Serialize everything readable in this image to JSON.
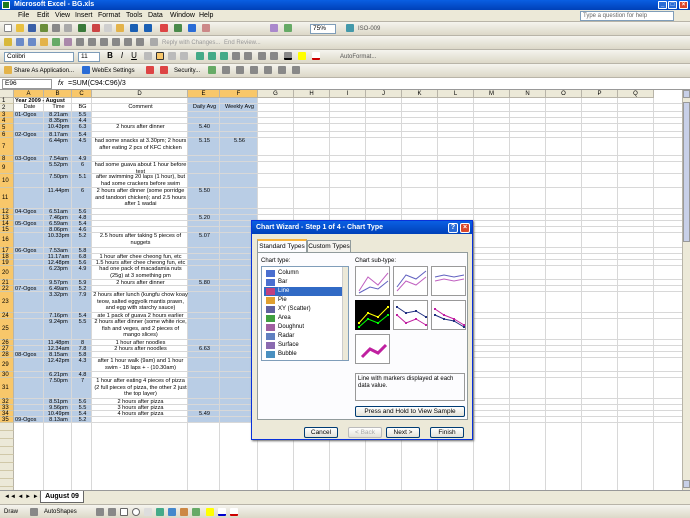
{
  "window": {
    "title": "Microsoft Excel - BG.xls"
  },
  "menu": [
    "File",
    "Edit",
    "View",
    "Insert",
    "Format",
    "Tools",
    "Data",
    "Window",
    "Help"
  ],
  "ask": "Type a question for help",
  "toolbar1": {
    "zoom": "75%",
    "font": "Colibri",
    "size": "11",
    "reply": "Reply with Changes...",
    "endreview": "End Review...",
    "dir": "ISO-009"
  },
  "toolbar2": {
    "share": "Share As Application...",
    "webex": "WebEx Settings",
    "security": "Security...",
    "autoformat": "AutoFormat..."
  },
  "formula": {
    "namebox": "E96",
    "fx": "fx",
    "value": "=SUM(C94:C96)/3"
  },
  "colors": {
    "selected": "#b9cde5",
    "header_sel": "#f8c76a",
    "title": "#0a5fe3"
  },
  "columns": [
    "A",
    "B",
    "C",
    "D",
    "E",
    "F",
    "G",
    "H",
    "I",
    "J",
    "K",
    "L",
    "M",
    "N",
    "O",
    "P",
    "Q"
  ],
  "rows": [
    {
      "n": "1",
      "a": "Year 2009 - August",
      "b": "",
      "c": "",
      "d": "",
      "e": "",
      "f": ""
    },
    {
      "n": "2",
      "a": "Date",
      "b": "Time",
      "c": "BG",
      "d": "Comment",
      "e": "Daily Avg",
      "f": "Weekly Avg"
    },
    {
      "n": "3",
      "a": "01-Ogos",
      "b": "8.21am",
      "c": "5.5",
      "d": "",
      "e": "",
      "f": ""
    },
    {
      "n": "4",
      "a": "",
      "b": "8.35pm",
      "c": "4.4",
      "d": "",
      "e": "",
      "f": ""
    },
    {
      "n": "5",
      "a": "",
      "b": "10.43pm",
      "c": "6.3",
      "d": "2 hours after dinner",
      "e": "5.40",
      "f": ""
    },
    {
      "n": "6",
      "a": "02-Ogos",
      "b": "8.17am",
      "c": "5.4",
      "d": "",
      "e": "",
      "f": ""
    },
    {
      "n": "7",
      "a": "",
      "b": "6.44pm",
      "c": "4.5",
      "d": "had some snacks at 3.30pm; 2 hours after eating 2 pcs of KFC chicken",
      "e": "5.15",
      "f": "5.56"
    },
    {
      "n": "8",
      "a": "03-Ogos",
      "b": "7.54am",
      "c": "4.9",
      "d": "",
      "e": "",
      "f": ""
    },
    {
      "n": "9",
      "a": "",
      "b": "5.52pm",
      "c": "6",
      "d": "had some guava about 1 hour before test",
      "e": "",
      "f": ""
    },
    {
      "n": "10",
      "a": "",
      "b": "7.50pm",
      "c": "5.1",
      "d": "after swimming 20 laps (1 hour), but had some crackers before swim",
      "e": "",
      "f": ""
    },
    {
      "n": "11",
      "a": "",
      "b": "11.44pm",
      "c": "6",
      "d": "2 hours after dinner (some porridge and tandoori chicken); and 2.5 hours after 1 wadai",
      "e": "5.50",
      "f": ""
    },
    {
      "n": "12",
      "a": "04-Ogos",
      "b": "6.51am",
      "c": "5.6",
      "d": "",
      "e": "",
      "f": ""
    },
    {
      "n": "13",
      "a": "",
      "b": "7.46pm",
      "c": "4.8",
      "d": "",
      "e": "5.20",
      "f": ""
    },
    {
      "n": "14",
      "a": "05-Ogos",
      "b": "6.59am",
      "c": "5.4",
      "d": "",
      "e": "",
      "f": ""
    },
    {
      "n": "15",
      "a": "",
      "b": "8.06pm",
      "c": "4.6",
      "d": "",
      "e": "",
      "f": ""
    },
    {
      "n": "16",
      "a": "",
      "b": "10.33pm",
      "c": "5.2",
      "d": "2.5 hours after taking 5 pieces of nuggets",
      "e": "5.07",
      "f": ""
    },
    {
      "n": "17",
      "a": "06-Ogos",
      "b": "7.53am",
      "c": "5.8",
      "d": "",
      "e": "",
      "f": ""
    },
    {
      "n": "18",
      "a": "",
      "b": "11.17am",
      "c": "6.8",
      "d": "1 hour after chee cheong fun, etc",
      "e": "",
      "f": ""
    },
    {
      "n": "19",
      "a": "",
      "b": "12.48pm",
      "c": "5.6",
      "d": "1.5 hours after chee cheong fun, etc",
      "e": "",
      "f": ""
    },
    {
      "n": "20",
      "a": "",
      "b": "6.23pm",
      "c": "4.9",
      "d": "had one pack of macadamia nuts (25g) at 3 something pm",
      "e": "",
      "f": ""
    },
    {
      "n": "21",
      "a": "",
      "b": "9.57pm",
      "c": "5.9",
      "d": "2 hours after dinner",
      "e": "5.80",
      "f": ""
    },
    {
      "n": "22",
      "a": "07-Ogos",
      "b": "6.49am",
      "c": "5.2",
      "d": "",
      "e": "",
      "f": ""
    },
    {
      "n": "23",
      "a": "",
      "b": "3.32pm",
      "c": "7.9",
      "d": "2 hours after lunch (kungfu chow koay teow, salted eggyolk mantis prawn, and egg with starchy sauce)",
      "e": "",
      "f": ""
    },
    {
      "n": "24",
      "a": "",
      "b": "7.16pm",
      "c": "5.4",
      "d": "ate 1 pack of guava 2 hours earlier",
      "e": "",
      "f": ""
    },
    {
      "n": "25",
      "a": "",
      "b": "9.24pm",
      "c": "5.5",
      "d": "2 hours after dinner (some white rice, fish and veges, and 2 pieces of mango slices)",
      "e": "",
      "f": ""
    },
    {
      "n": "26",
      "a": "",
      "b": "11.48pm",
      "c": "8",
      "d": "1 hour after noodles",
      "e": "",
      "f": ""
    },
    {
      "n": "27",
      "a": "",
      "b": "12.34am",
      "c": "7.8",
      "d": "2 hours after noodles",
      "e": "6.63",
      "f": ""
    },
    {
      "n": "28",
      "a": "08-Ogos",
      "b": "8.15am",
      "c": "5.8",
      "d": "",
      "e": "",
      "f": ""
    },
    {
      "n": "29",
      "a": "",
      "b": "12.42pm",
      "c": "4.3",
      "d": "after 1 hour walk (9am) and 1 hour swim - 18 laps + - (10.30am)",
      "e": "",
      "f": ""
    },
    {
      "n": "30",
      "a": "",
      "b": "6.21pm",
      "c": "4.8",
      "d": "",
      "e": "",
      "f": ""
    },
    {
      "n": "31",
      "a": "",
      "b": "7.50pm",
      "c": "7",
      "d": "1 hour after eating 4 pieces of pizza (2 full pieces of pizza, the other 2 just the top layer)",
      "e": "",
      "f": ""
    },
    {
      "n": "32",
      "a": "",
      "b": "8.51pm",
      "c": "5.6",
      "d": "2 hours after pizza",
      "e": "",
      "f": ""
    },
    {
      "n": "33",
      "a": "",
      "b": "9.56pm",
      "c": "5.5",
      "d": "3 hours after pizza",
      "e": "",
      "f": ""
    },
    {
      "n": "34",
      "a": "",
      "b": "10.49pm",
      "c": "5.4",
      "d": "4 hours after pizza",
      "e": "5.49",
      "f": ""
    },
    {
      "n": "35",
      "a": "09-Ogos",
      "b": "8.13am",
      "c": "5.2",
      "d": "",
      "e": "",
      "f": ""
    }
  ],
  "sheet_tab": "August 09",
  "drawbar": {
    "draw": "Draw",
    "autoshapes": "AutoShapes"
  },
  "dialog": {
    "title": "Chart Wizard - Step 1 of 4 - Chart Type",
    "tabs": [
      "Standard Types",
      "Custom Types"
    ],
    "chart_type_label": "Chart type:",
    "sub_type_label": "Chart sub-type:",
    "types": [
      "Column",
      "Bar",
      "Line",
      "Pie",
      "XY (Scatter)",
      "Area",
      "Doughnut",
      "Radar",
      "Surface",
      "Bubble"
    ],
    "selected_type": "Line",
    "description": "Line with markers displayed at each data value.",
    "press_hold": "Press and Hold to View Sample",
    "buttons": {
      "cancel": "Cancel",
      "back": "< Back",
      "next": "Next >",
      "finish": "Finish"
    }
  }
}
